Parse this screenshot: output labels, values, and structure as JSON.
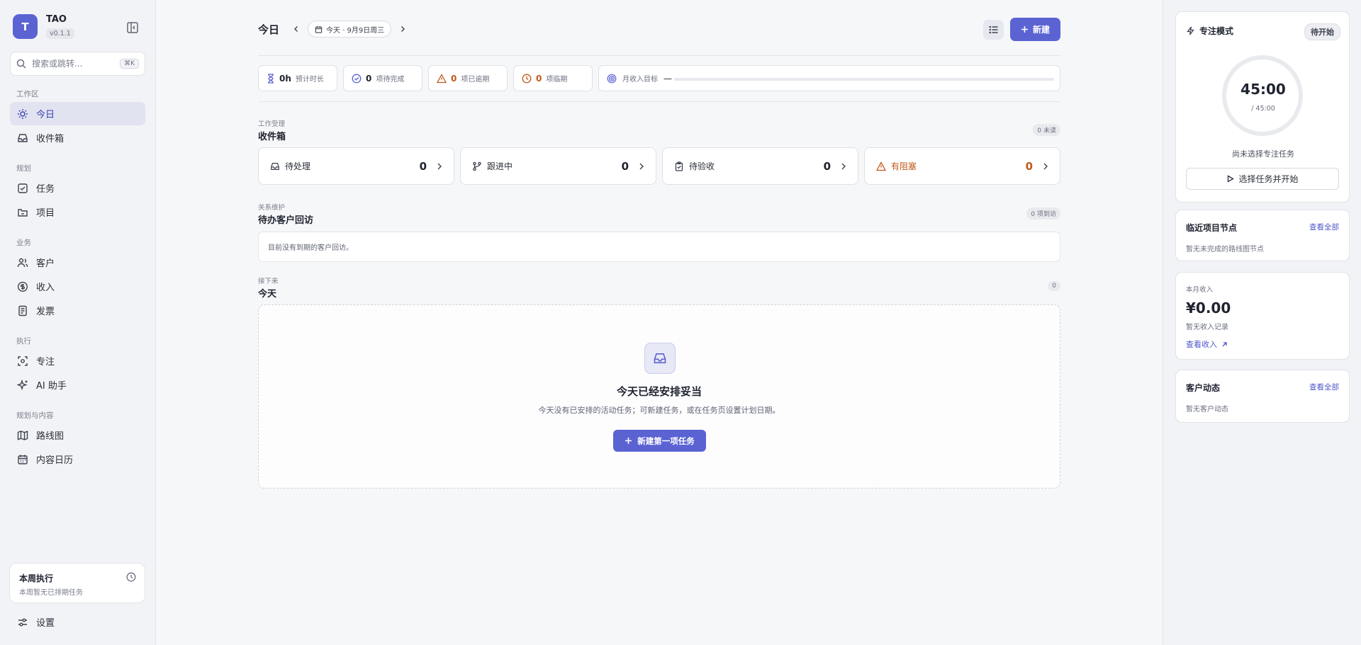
{
  "brand": {
    "initial": "T",
    "name": "TAO",
    "version": "v0.1.1"
  },
  "search": {
    "placeholder": "搜索或跳转...",
    "shortcut": "⌘K"
  },
  "sidebar": {
    "sections": [
      "工作区",
      "规划",
      "业务",
      "执行",
      "规划与内容"
    ],
    "items": [
      {
        "label": "今日",
        "icon": "sun-icon",
        "active": true
      },
      {
        "label": "收件箱",
        "icon": "inbox-icon"
      },
      {
        "label": "任务",
        "icon": "checkbox-icon"
      },
      {
        "label": "项目",
        "icon": "folder-icon"
      },
      {
        "label": "客户",
        "icon": "users-icon"
      },
      {
        "label": "收入",
        "icon": "dollar-icon"
      },
      {
        "label": "发票",
        "icon": "file-icon"
      },
      {
        "label": "专注",
        "icon": "focus-icon"
      },
      {
        "label": "AI 助手",
        "icon": "sparkles-icon"
      },
      {
        "label": "路线图",
        "icon": "map-icon"
      },
      {
        "label": "内容日历",
        "icon": "calendar-icon"
      }
    ],
    "week_card": {
      "title": "本周执行",
      "subtitle": "本周暂无已排期任务"
    },
    "settings_label": "设置"
  },
  "header": {
    "title": "今日",
    "date": "今天 · 9月9日周三",
    "new_label": "新建"
  },
  "stats": [
    {
      "value": "0h",
      "label": "预计时长"
    },
    {
      "value": "0",
      "label": "项待完成"
    },
    {
      "value": "0",
      "label": "项已逾期"
    },
    {
      "value": "0",
      "label": "项临期"
    }
  ],
  "goal": {
    "label": "月收入目标",
    "value": "—",
    "progress": 0
  },
  "inbox": {
    "kicker": "工作受理",
    "title": "收件箱",
    "badge": "0 未读",
    "cards": [
      {
        "label": "待处理",
        "count": "0"
      },
      {
        "label": "跟进中",
        "count": "0"
      },
      {
        "label": "待验收",
        "count": "0"
      },
      {
        "label": "有阻塞",
        "count": "0"
      }
    ]
  },
  "visits": {
    "kicker": "关系维护",
    "title": "待办客户回访",
    "badge": "0 项到访",
    "empty": "目前没有到期的客户回访。"
  },
  "today": {
    "kicker": "接下来",
    "title": "今天",
    "badge": "0",
    "empty_title": "今天已经安排妥当",
    "empty_desc": "今天没有已安排的活动任务；可新建任务，或在任务页设置计划日期。",
    "button": "新建第一项任务"
  },
  "focus": {
    "title": "专注模式",
    "status": "待开始",
    "time": "45:00",
    "total": "/ 45:00",
    "none": "尚未选择专注任务",
    "start": "选择任务并开始"
  },
  "milestones": {
    "title": "临近项目节点",
    "link": "查看全部",
    "empty": "暂无未完成的路线图节点"
  },
  "income": {
    "kicker": "本月收入",
    "amount": "¥0.00",
    "empty": "暂无收入记录",
    "link": "查看收入"
  },
  "activity": {
    "title": "客户动态",
    "link": "查看全部",
    "empty": "暂无客户动态"
  },
  "colors": {
    "accent": "#5b63d3",
    "warning": "#c0581b"
  }
}
